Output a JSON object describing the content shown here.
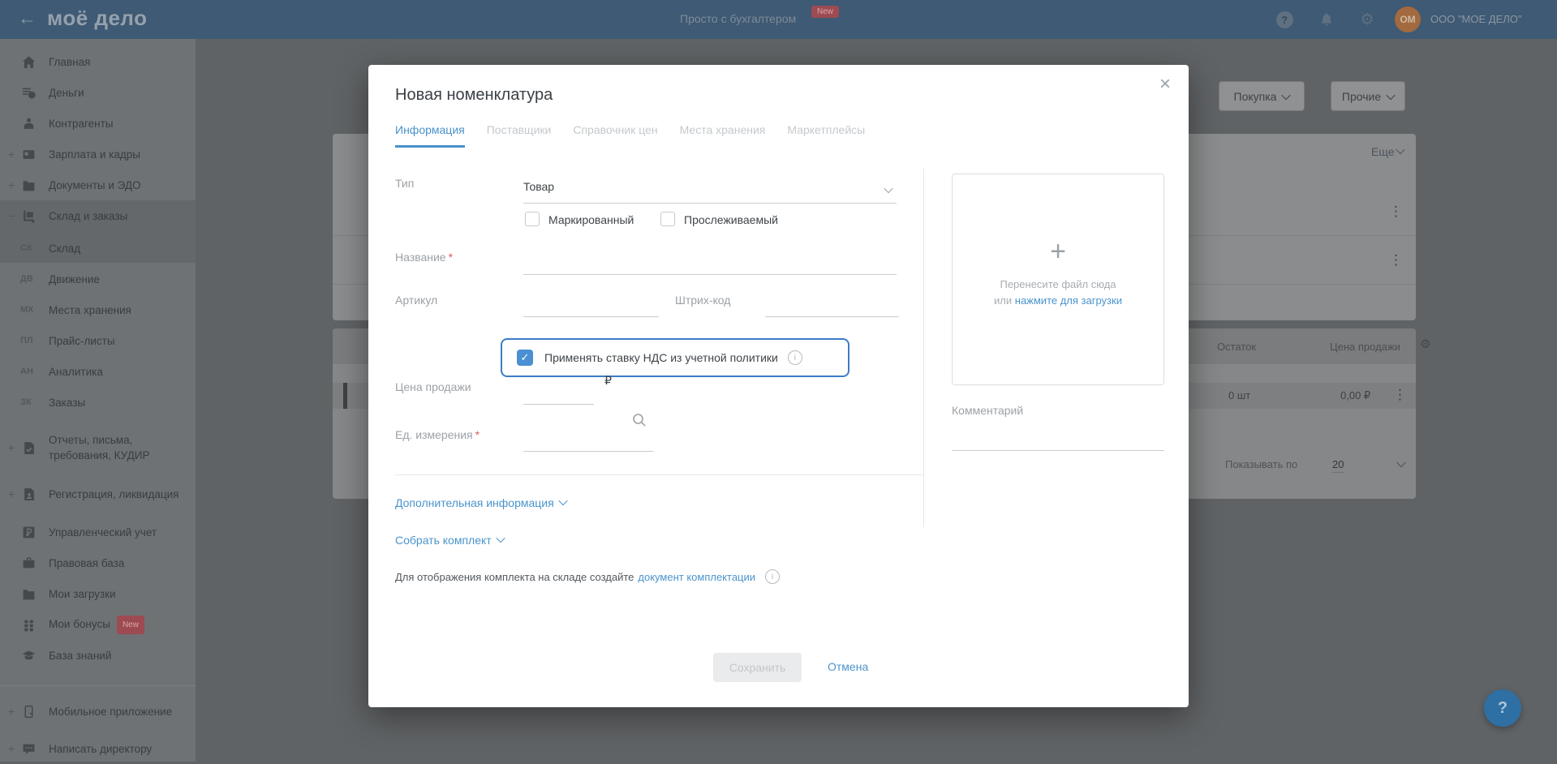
{
  "icons": {
    "back_arrow": "←",
    "gear": "⚙",
    "kebab": "⋮",
    "close": "×",
    "plus": "+",
    "question": "?",
    "info": "i",
    "check": "✓",
    "required": "*"
  },
  "colors": {
    "topbar": "#3E5A74",
    "accent_blue": "#4B94CC",
    "vat_border": "#3C7CC8",
    "badge_red": "#9E4A52",
    "disabled_btn": "#E9EBEC"
  },
  "topbar": {
    "logo": "моё дело",
    "promo": "Просто с бухгалтером",
    "promo_badge": "New",
    "avatar_initials": "ОМ",
    "company": "ООО \"МОЕ ДЕЛО\""
  },
  "sidebar": {
    "items": [
      {
        "label": "Главная"
      },
      {
        "label": "Деньги"
      },
      {
        "label": "Контрагенты"
      },
      {
        "label": "Зарплата и кадры",
        "expand": "+"
      },
      {
        "label": "Документы и ЭДО",
        "expand": "+"
      },
      {
        "label": "Склад и заказы",
        "expand": "−"
      },
      {
        "label": "Склад",
        "abbr": "СК"
      },
      {
        "label": "Движение",
        "abbr": "ДВ"
      },
      {
        "label": "Места хранения",
        "abbr": "МХ"
      },
      {
        "label": "Прайс-листы",
        "abbr": "ПЛ"
      },
      {
        "label": "Аналитика",
        "abbr": "АН"
      },
      {
        "label": "Заказы",
        "abbr": "ЗК"
      },
      {
        "label": "Отчеты, письма, требования, КУДИР",
        "expand": "+"
      },
      {
        "label": "Регистрация, ликвидация",
        "expand": "+"
      },
      {
        "label": "Управленческий учет"
      },
      {
        "label": "Правовая база"
      },
      {
        "label": "Мои загрузки"
      },
      {
        "label": "Мои бонусы",
        "badge": "New"
      },
      {
        "label": "База знаний"
      },
      {
        "label": "Мобильное приложение",
        "expand": "+"
      },
      {
        "label": "Написать директору",
        "expand": "+"
      }
    ]
  },
  "background": {
    "buy_button": "Покупка",
    "other_button": "Прочие",
    "more_link": "Еще",
    "table": {
      "header_stock": "Остаток",
      "header_price": "Цена продажи",
      "row_stock": "0 шт",
      "row_price": "0,00 ₽"
    },
    "pagination_label": "Показывать по",
    "pagination_value": "20"
  },
  "modal": {
    "title": "Новая номенклатура",
    "tabs": [
      {
        "label": "Информация"
      },
      {
        "label": "Поставщики"
      },
      {
        "label": "Справочник цен"
      },
      {
        "label": "Места хранения"
      },
      {
        "label": "Маркетплейсы"
      }
    ],
    "form": {
      "type_label": "Тип",
      "type_value": "Товар",
      "marked_checkbox": "Маркированный",
      "traceable_checkbox": "Прослеживаемый",
      "name_label": "Название",
      "article_label": "Артикул",
      "barcode_label": "Штрих-код",
      "vat_checkbox": "Применять ставку НДС из учетной политики",
      "price_label": "Цена продажи",
      "currency": "₽",
      "unit_label": "Ед. измерения"
    },
    "links": {
      "additional_info": "Дополнительная информация",
      "assemble_kit": "Собрать комплект"
    },
    "kit_note_text": "Для отображения комплекта на складе создайте",
    "kit_note_link": "документ комплектации",
    "upload": {
      "drag_text": "Перенесите файл сюда",
      "or_text": "или",
      "click_link": "нажмите для загрузки"
    },
    "comment_label": "Комментарий",
    "save_button": "Сохранить",
    "cancel_button": "Отмена"
  }
}
